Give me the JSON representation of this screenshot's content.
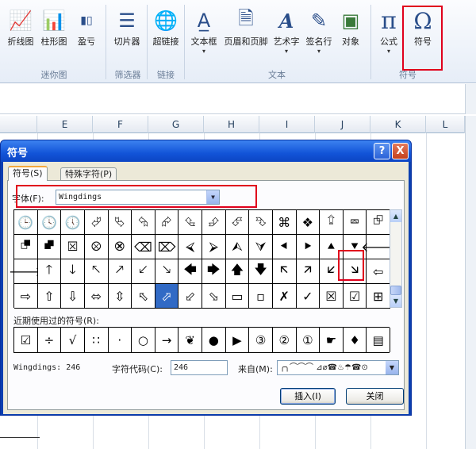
{
  "ribbon": {
    "buttons": [
      {
        "label": "折线图",
        "icon": "line-chart-icon",
        "glyph": "📈"
      },
      {
        "label": "柱形图",
        "icon": "column-chart-icon",
        "glyph": "📊"
      },
      {
        "label": "盈亏",
        "icon": "win-loss-icon",
        "glyph": "▮▯"
      },
      {
        "label": "切片器",
        "icon": "slicer-icon",
        "glyph": "☰"
      },
      {
        "label": "超链接",
        "icon": "hyperlink-icon",
        "glyph": "🌐"
      },
      {
        "label": "文本框",
        "icon": "textbox-icon",
        "glyph": "A̲"
      },
      {
        "label": "页眉和页脚",
        "icon": "header-footer-icon",
        "glyph": "🗎"
      },
      {
        "label": "艺术字",
        "icon": "wordart-icon",
        "glyph": "A"
      },
      {
        "label": "签名行",
        "icon": "signature-line-icon",
        "glyph": "✎"
      },
      {
        "label": "对象",
        "icon": "object-icon",
        "glyph": "▣"
      },
      {
        "label": "公式",
        "icon": "equation-icon",
        "glyph": "π"
      },
      {
        "label": "符号",
        "icon": "symbol-icon",
        "glyph": "Ω"
      }
    ],
    "groups": [
      "迷你图",
      "筛选器",
      "链接",
      "文本",
      "符号"
    ]
  },
  "sheet": {
    "columns": [
      "E",
      "F",
      "G",
      "H",
      "I",
      "J",
      "K",
      "L"
    ]
  },
  "dialog": {
    "title": "符号",
    "help": "?",
    "close": "X",
    "tabs": [
      "符号(S)",
      "特殊字符(P)"
    ],
    "font_label": "字体(F):",
    "font_value": "Wingdings",
    "symbols": [
      "🕒",
      "🕓",
      "🕔",
      "⮰",
      "⮱",
      "⮲",
      "⮳",
      "⮴",
      "⮵",
      "⮶",
      "⮷",
      "⌘",
      "❖",
      "⮸",
      "⮹",
      "⮺",
      "⮻",
      "⮼",
      "⮽",
      "⮾",
      "⮿",
      "⌫",
      "⌦",
      "⮘",
      "⮚",
      "⮙",
      "⮛",
      "⯇",
      "⯈",
      "⯅",
      "⯆",
      "🡐",
      "🡒",
      "🡑",
      "🡓",
      "🡔",
      "🡕",
      "🡗",
      "🡖",
      "🡄",
      "🡆",
      "🡅",
      "🡇",
      "🡬",
      "🡭",
      "🡯",
      "🡮",
      "⇦",
      "⇨",
      "⇧",
      "⇩",
      "⬄",
      "⇳",
      "⬁",
      "⬀",
      "⬃",
      "⬂",
      "▭",
      "▫",
      "✗",
      "✓",
      "☒",
      "☑",
      "⊞"
    ],
    "selected_index": 54,
    "recent_label": "近期使用过的符号(R):",
    "recent": [
      "☑",
      "÷",
      "√",
      "∷",
      "·",
      "○",
      "→",
      "❦",
      "●",
      "▶",
      "③",
      "②",
      "①",
      "☛",
      "♦",
      "▤"
    ],
    "font_info": "Wingdings: 246",
    "code_label": "字符代码(C):",
    "code_value": "246",
    "from_label": "来自(M):",
    "from_value": "╭╮⌒⌒⌒ ⊿⌀☎♨☂☎⊙",
    "insert_label": "插入(I)",
    "close_label": "关闭"
  }
}
